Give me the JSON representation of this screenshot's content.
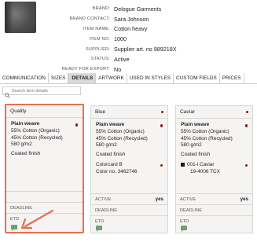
{
  "properties": [
    {
      "label": "BRAND:",
      "value": "Delogue Garments"
    },
    {
      "label": "BRAND CONTACT:",
      "value": "Sara Johnson"
    },
    {
      "label": "ITEM NAME:",
      "value": "Cotton heavy"
    },
    {
      "label": "ITEM NO:",
      "value": "1000"
    },
    {
      "label": "SUPPLIER:",
      "value": "Supplier art. no 989218X"
    },
    {
      "label": "STATUS:",
      "value": "Active"
    },
    {
      "label": "READY FOR EXPORT:",
      "value": "No"
    }
  ],
  "tabs": [
    "COMMUNICATION",
    "SIZES",
    "DETAILS",
    "ARTWORK",
    "USED IN STYLES",
    "CUSTOM FIELDS",
    "PRICES"
  ],
  "active_tab": "DETAILS",
  "search": {
    "placeholder": "Search item details"
  },
  "cards": [
    {
      "title": "Quality",
      "material": {
        "name": "Plain weave",
        "lines": [
          "55% Cotton (Organic)",
          "45% Cotton (Recycled)",
          "580 g/m2",
          "Coated finish"
        ]
      },
      "color": null,
      "active": "",
      "deadline_label": "DEADLINE",
      "etd_label": "ETD"
    },
    {
      "title": "Blue",
      "material": {
        "name": "Plain weave",
        "lines": [
          "55% Cotton (Organic)",
          "45% Cotton (Recycled)",
          "580 g/m2",
          "Coated finish"
        ]
      },
      "color": {
        "line1": "Colorcard B",
        "line2": "Color no. 3462746"
      },
      "active_label": "ACTIVE",
      "active_value": "yes",
      "deadline_label": "DEADLINE",
      "etd_label": "ETD"
    },
    {
      "title": "Caviar",
      "material": {
        "name": "Plain weave",
        "lines": [
          "55% Cotton (Organic)",
          "45% Cotton (Recycled)",
          "580 g/m2",
          "Coated finish"
        ]
      },
      "color": {
        "line1": "001-i Caviar",
        "line2": "19-4006 TCX"
      },
      "active_label": "ACTIVE",
      "active_value": "yes",
      "deadline_label": "DEADLINE",
      "etd_label": "ETD"
    }
  ],
  "colors": {
    "highlight": "#e4704e",
    "dot": "#8a1c1c",
    "comment": "#6ea26e"
  }
}
